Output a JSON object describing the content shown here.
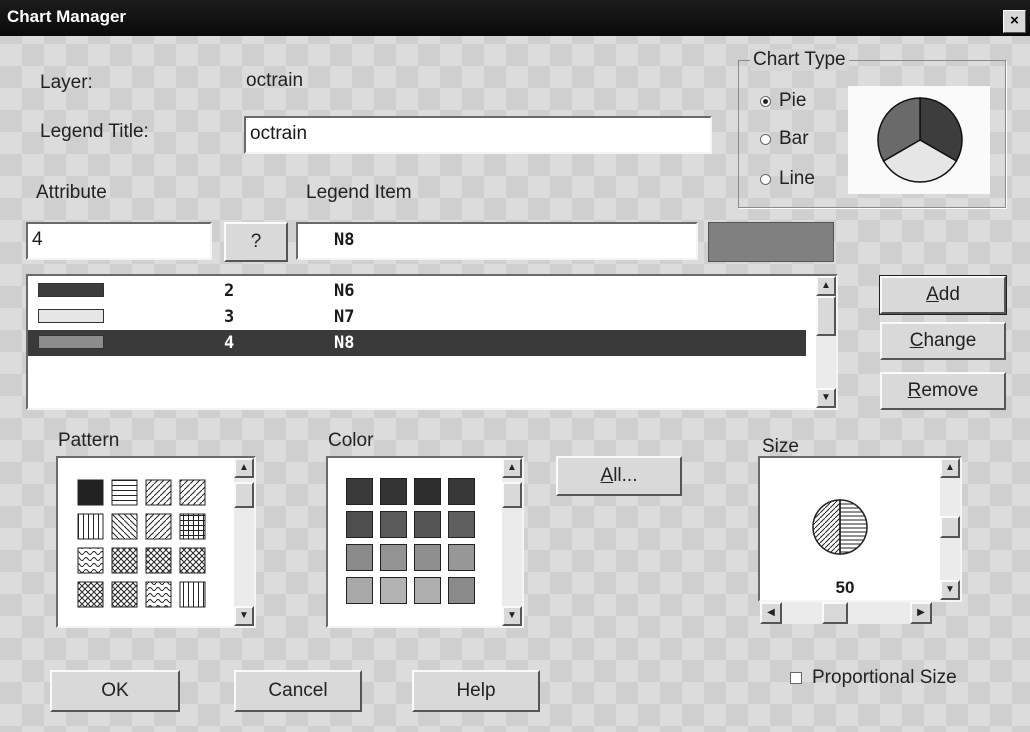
{
  "window": {
    "title": "Chart Manager",
    "close_label": "×"
  },
  "layer": {
    "label": "Layer:",
    "value": "octrain"
  },
  "legend_title": {
    "label": "Legend Title:",
    "value": "octrain"
  },
  "chart_type": {
    "label": "Chart Type",
    "options": [
      "Pie",
      "Bar",
      "Line"
    ],
    "selected": "Pie"
  },
  "attribute": {
    "label": "Attribute",
    "value": "4"
  },
  "legend_item": {
    "label": "Legend Item",
    "value": "N8",
    "swatch_color": "#808080"
  },
  "query_button": "?",
  "legend_list": [
    {
      "attribute": "2",
      "item": "N6",
      "color": "#3d3d3d",
      "selected": false
    },
    {
      "attribute": "3",
      "item": "N7",
      "color": "#e6e6e6",
      "selected": false
    },
    {
      "attribute": "4",
      "item": "N8",
      "color": "#8c8c8c",
      "selected": true
    }
  ],
  "buttons": {
    "add": {
      "mnemonic": "A",
      "rest": "dd"
    },
    "change": {
      "mnemonic": "C",
      "rest": "hange"
    },
    "remove": {
      "mnemonic": "R",
      "rest": "emove"
    },
    "all": {
      "mnemonic": "A",
      "rest": "ll..."
    },
    "ok": "OK",
    "cancel": "Cancel",
    "help": "Help"
  },
  "pattern": {
    "label": "Pattern"
  },
  "color": {
    "label": "Color",
    "palette": [
      "#3a3a3a",
      "#333333",
      "#2e2e2e",
      "#383838",
      "#4e4e4e",
      "#5a5a5a",
      "#555555",
      "#5f5f5f",
      "#8a8a8a",
      "#939393",
      "#8f8f8f",
      "#979797",
      "#a8a8a8",
      "#b3b3b3",
      "#afafaf",
      "#8a8a8a"
    ]
  },
  "size": {
    "label": "Size",
    "value": "50"
  },
  "proportional_size": {
    "label": "Proportional Size",
    "checked": false
  },
  "pie_preview_colors": [
    "#3d3d3d",
    "#6a6a6a",
    "#e6e6e6"
  ]
}
